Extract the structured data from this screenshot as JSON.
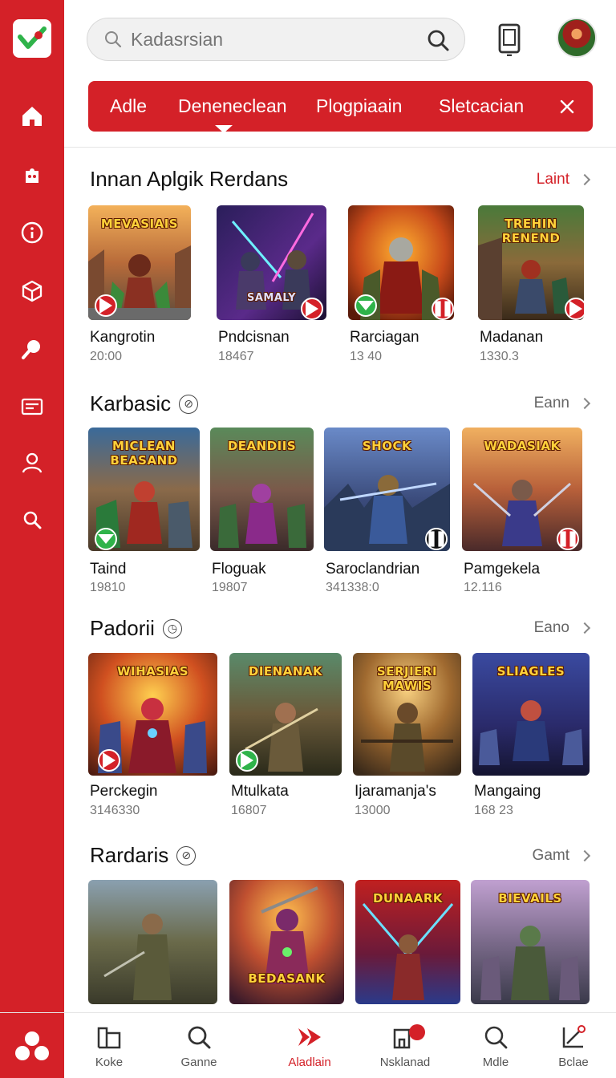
{
  "header": {
    "search_placeholder": "Kadasrsian"
  },
  "tabs": [
    {
      "label": "Adle"
    },
    {
      "label": "Deneneclean"
    },
    {
      "label": "Plogpiaain"
    },
    {
      "label": "Sletcacian"
    }
  ],
  "sections": [
    {
      "title": "Innan Aplgik Rerdans",
      "more": "Laint",
      "cards": [
        {
          "art_title": "MEVASIAIS",
          "name": "Kangrotin",
          "count": "20:00",
          "badge_color": "#d42128"
        },
        {
          "art_title": "SAMALY",
          "name": "Pndcisnan",
          "count": "18467",
          "badge_color": "#d42128"
        },
        {
          "art_title": "",
          "name": "Rarciagan",
          "count": "13 40",
          "badge_color": "#2fb34a"
        },
        {
          "art_title": "TREHIN RENEND",
          "name": "Madanan",
          "count": "1330.3",
          "badge_color": "#d42128"
        }
      ]
    },
    {
      "title": "Karbasic",
      "more": "Eann",
      "cards": [
        {
          "art_title": "MICLEAN BEASAND",
          "name": "Taind",
          "count": "19810",
          "badge_color": "#2fb34a"
        },
        {
          "art_title": "DEANDIIS",
          "name": "Floguak",
          "count": "19807",
          "badge_color": ""
        },
        {
          "art_title": "SHOCK",
          "name": "Saroclandrian",
          "count": "341338:0",
          "badge_color": "#111111"
        },
        {
          "art_title": "WADASIAK",
          "name": "Pamgekela",
          "count": "12.116",
          "badge_color": "#d42128"
        }
      ]
    },
    {
      "title": "Padorii",
      "more": "Eano",
      "cards": [
        {
          "art_title": "WIHASIAS",
          "name": "Perckegin",
          "count": "3146330",
          "badge_color": "#d42128"
        },
        {
          "art_title": "DIENANAK",
          "name": "Mtulkata",
          "count": "16807",
          "badge_color": "#2fb34a"
        },
        {
          "art_title": "SERJIERI MAWIS",
          "name": "Ijaramanja's",
          "count": "13000",
          "badge_color": ""
        },
        {
          "art_title": "SLIAGLES",
          "name": "Mangaing",
          "count": "168 23",
          "badge_color": ""
        }
      ]
    },
    {
      "title": "Rardaris",
      "more": "Gamt",
      "cards": [
        {
          "art_title": "",
          "name": "",
          "count": "",
          "badge_color": ""
        },
        {
          "art_title": "BEDASANK",
          "name": "",
          "count": "",
          "badge_color": ""
        },
        {
          "art_title": "DUNAARK",
          "name": "",
          "count": "",
          "badge_color": ""
        },
        {
          "art_title": "BIEVAILS",
          "name": "",
          "count": "",
          "badge_color": ""
        }
      ]
    }
  ],
  "bottom_nav": [
    {
      "label": "Koke"
    },
    {
      "label": "Ganne"
    },
    {
      "label": "Aladlain"
    },
    {
      "label": "Nsklanad"
    },
    {
      "label": "Mdle"
    },
    {
      "label": "Bclae"
    }
  ],
  "colors": {
    "accent": "#d42128",
    "green_badge": "#2fb34a"
  }
}
